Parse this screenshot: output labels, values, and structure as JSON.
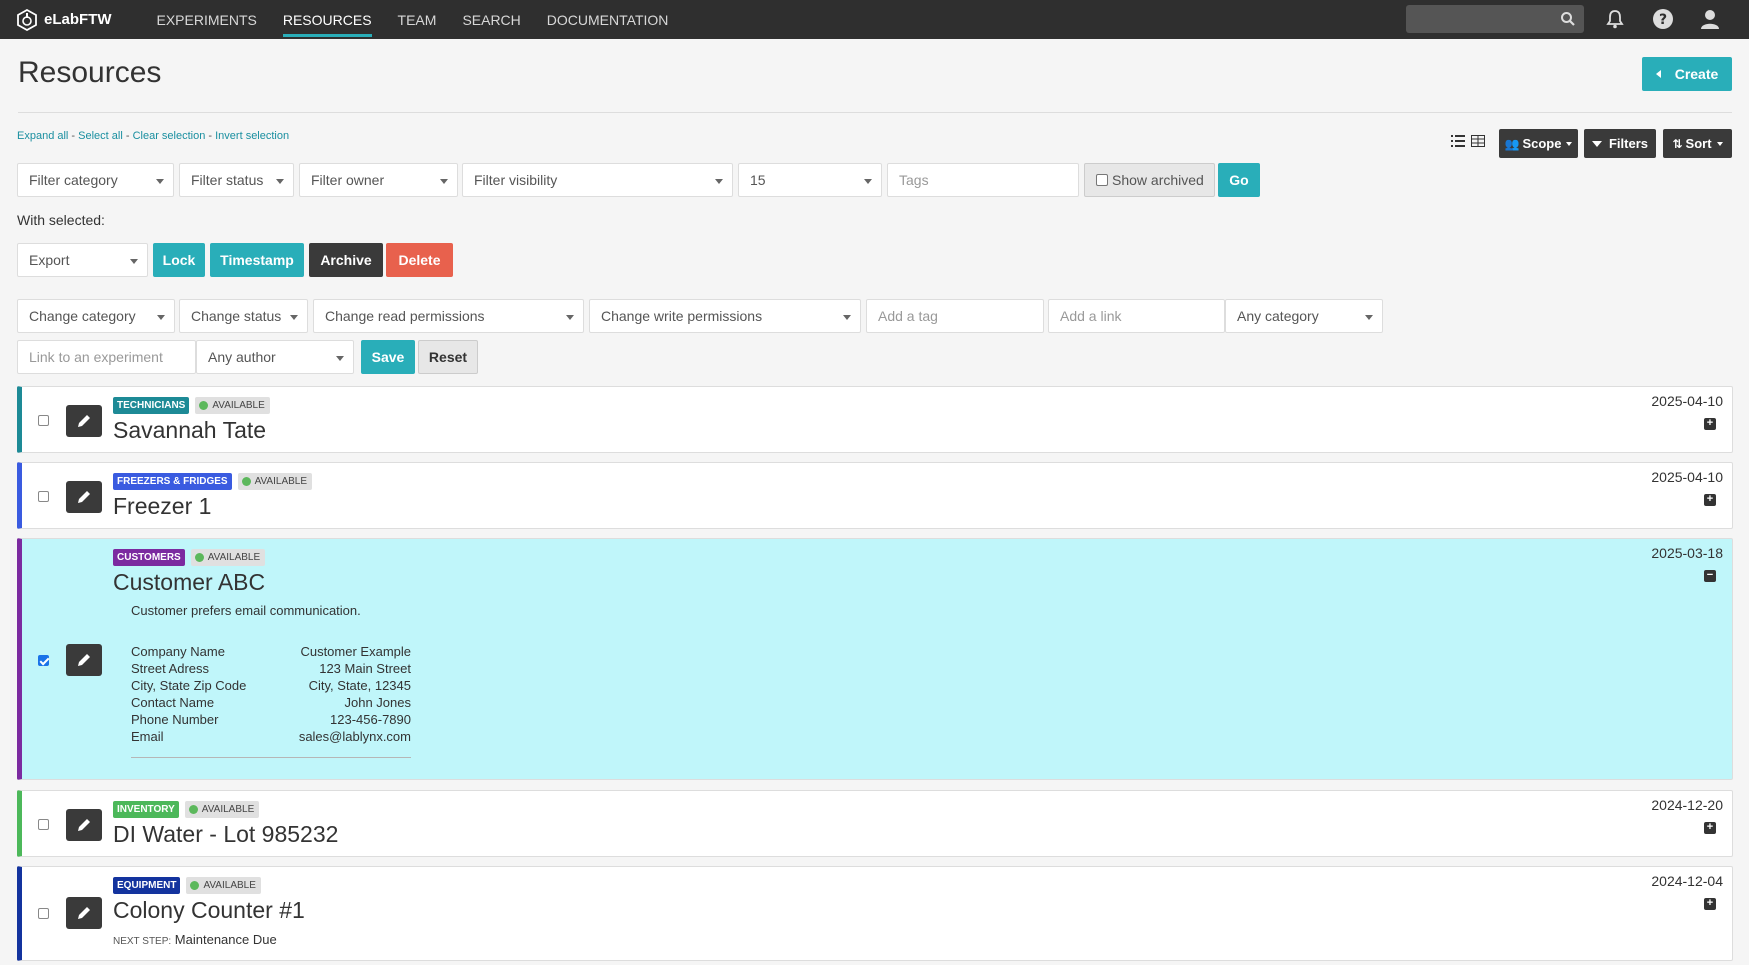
{
  "app": {
    "name": "eLabFTW",
    "nav": [
      {
        "label": "EXPERIMENTS"
      },
      {
        "label": "RESOURCES"
      },
      {
        "label": "TEAM"
      },
      {
        "label": "SEARCH"
      },
      {
        "label": "DOCUMENTATION"
      }
    ]
  },
  "page": {
    "title": "Resources",
    "create_label": "Create"
  },
  "selection_links": {
    "expand_all": "Expand all",
    "select_all": "Select all",
    "clear_selection": "Clear selection",
    "invert_selection": "Invert selection",
    "separator": " - "
  },
  "toolbar": {
    "scope_label": "Scope",
    "filters_label": "Filters",
    "sort_label": "Sort"
  },
  "filters": {
    "category": "Filter category",
    "status": "Filter status",
    "owner": "Filter owner",
    "visibility": "Filter visibility",
    "limit": "15",
    "tags_placeholder": "Tags",
    "show_archived": "Show archived",
    "go_label": "Go"
  },
  "with_selected": {
    "label": "With selected:",
    "export": "Export",
    "lock": "Lock",
    "timestamp": "Timestamp",
    "archive": "Archive",
    "delete": "Delete",
    "change_category": "Change category",
    "change_status": "Change status",
    "change_read": "Change read permissions",
    "change_write": "Change write permissions",
    "add_tag_placeholder": "Add a tag",
    "add_link_placeholder": "Add a link",
    "any_category": "Any category",
    "link_experiment_placeholder": "Link to an experiment",
    "any_author": "Any author",
    "save": "Save",
    "reset": "Reset"
  },
  "items": [
    {
      "category": "TECHNICIANS",
      "category_color": "#1d8a96",
      "status": "AVAILABLE",
      "title": "Savannah Tate",
      "date": "2025-04-10",
      "selected": false
    },
    {
      "category": "FREEZERS & FRIDGES",
      "category_color": "#3a5be0",
      "status": "AVAILABLE",
      "title": "Freezer 1",
      "date": "2025-04-10",
      "selected": false
    },
    {
      "category": "CUSTOMERS",
      "category_color": "#7b2aa0",
      "status": "AVAILABLE",
      "title": "Customer ABC",
      "date": "2025-03-18",
      "selected": true,
      "description": "Customer prefers email communication.",
      "fields": [
        {
          "name": "Company Name",
          "value": "Customer Example"
        },
        {
          "name": "Street Adress",
          "value": "123 Main Street"
        },
        {
          "name": "City, State Zip Code",
          "value": "City, State, 12345"
        },
        {
          "name": "Contact Name",
          "value": "John Jones"
        },
        {
          "name": "Phone Number",
          "value": "123-456-7890"
        },
        {
          "name": "Email",
          "value": "sales@lablynx.com"
        }
      ]
    },
    {
      "category": "INVENTORY",
      "category_color": "#4cb85a",
      "status": "AVAILABLE",
      "title": "DI Water - Lot 985232",
      "date": "2024-12-20",
      "selected": false
    },
    {
      "category": "EQUIPMENT",
      "category_color": "#13339e",
      "status": "AVAILABLE",
      "title": "Colony Counter #1",
      "date": "2024-12-04",
      "selected": false,
      "next_step_label": "NEXT STEP:",
      "next_step": "Maintenance Due"
    }
  ]
}
